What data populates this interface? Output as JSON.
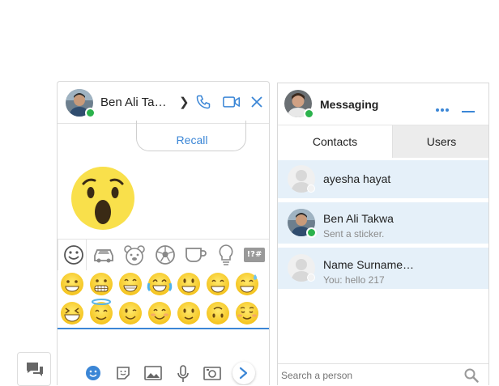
{
  "chat": {
    "contact_name": "Ben Ali Tak…",
    "recall_label": "Recall",
    "accent_color": "#3b86d6",
    "emoji_tabs": [
      "smiley-icon",
      "car-icon",
      "bear-icon",
      "soccer-ball-icon",
      "cup-icon",
      "lightbulb-icon",
      "symbols-icon"
    ],
    "emoji_tab_symbols_label": "!?#",
    "emojis_row1": [
      "grinning",
      "grimacing",
      "grin",
      "joy",
      "smiley",
      "smile",
      "sweat-smile"
    ],
    "emojis_row2": [
      "laughing",
      "innocent",
      "wink",
      "blush",
      "slight-smile",
      "upside-down",
      "relaxed"
    ],
    "toolbar": [
      "emoji-icon",
      "sticker-icon",
      "image-icon",
      "mic-icon",
      "camera-icon",
      "send-icon"
    ]
  },
  "messaging": {
    "title": "Messaging",
    "tabs": [
      "Contacts",
      "Users"
    ],
    "active_tab": "Contacts",
    "contacts": [
      {
        "name": "ayesha hayat",
        "sub": ""
      },
      {
        "name": "Ben Ali Takwa",
        "sub": "Sent a sticker."
      },
      {
        "name": "Name Surname…",
        "sub": "You: hello 217"
      }
    ],
    "search_placeholder": "Search a person"
  }
}
